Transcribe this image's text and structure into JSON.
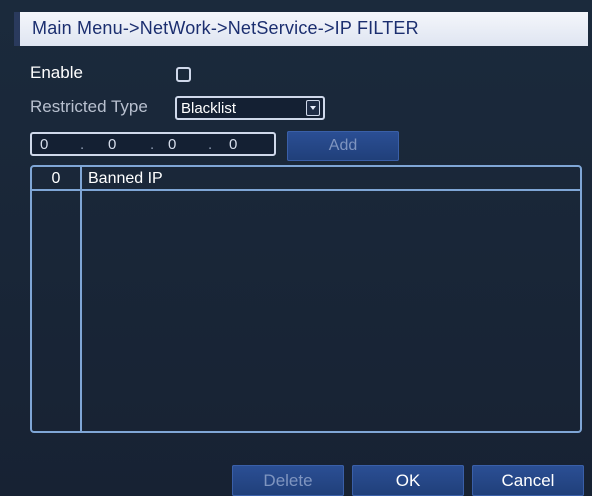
{
  "window": {
    "breadcrumb": "Main Menu->NetWork->NetService->IP FILTER"
  },
  "form": {
    "enable_label": "Enable",
    "enable_checked": false,
    "restricted_type_label": "Restricted Type",
    "restricted_type_value": "Blacklist",
    "ip": [
      "0",
      "0",
      "0",
      "0"
    ],
    "ip_separator": ".",
    "add_label": "Add"
  },
  "table": {
    "col_index": "0",
    "col_banned_ip": "Banned IP",
    "rows": []
  },
  "buttons": {
    "delete": "Delete",
    "ok": "OK",
    "cancel": "Cancel"
  },
  "icons": {
    "checkbox": "checkbox-icon",
    "dropdown": "dropdown-arrow-icon"
  }
}
